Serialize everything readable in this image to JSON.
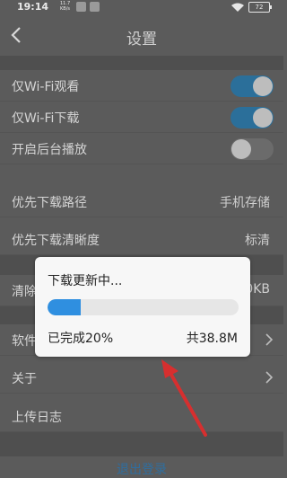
{
  "status_bar": {
    "time": "19:14",
    "net_speed": "11.7",
    "net_unit": "KB/s",
    "battery": "72"
  },
  "header": {
    "title": "设置",
    "back_icon": "chevron-left-icon"
  },
  "settings": {
    "wifi_watch": {
      "label": "仅Wi-Fi观看",
      "on": true
    },
    "wifi_download": {
      "label": "仅Wi-Fi下载",
      "on": true
    },
    "background_play": {
      "label": "开启后台播放",
      "on": false
    },
    "download_path": {
      "label": "优先下载路径",
      "value": "手机存储"
    },
    "download_quality": {
      "label": "优先下载清晰度",
      "value": "标清"
    },
    "clear_cache": {
      "label": "清除",
      "value": "0KB"
    },
    "software_update": {
      "label": "软件"
    },
    "about": {
      "label": "关于"
    },
    "upload_log": {
      "label": "上传日志"
    },
    "logout": {
      "label": "退出登录"
    }
  },
  "dialog": {
    "title": "下载更新中...",
    "progress_fraction": 0.2,
    "status": "已完成20%",
    "size": "共38.8M"
  },
  "colors": {
    "toggle_on": "#2b6f9a",
    "progress_fill": "#2f8fe0",
    "annotation_arrow": "#d62f2f",
    "logout_text": "#2f6e9f"
  }
}
